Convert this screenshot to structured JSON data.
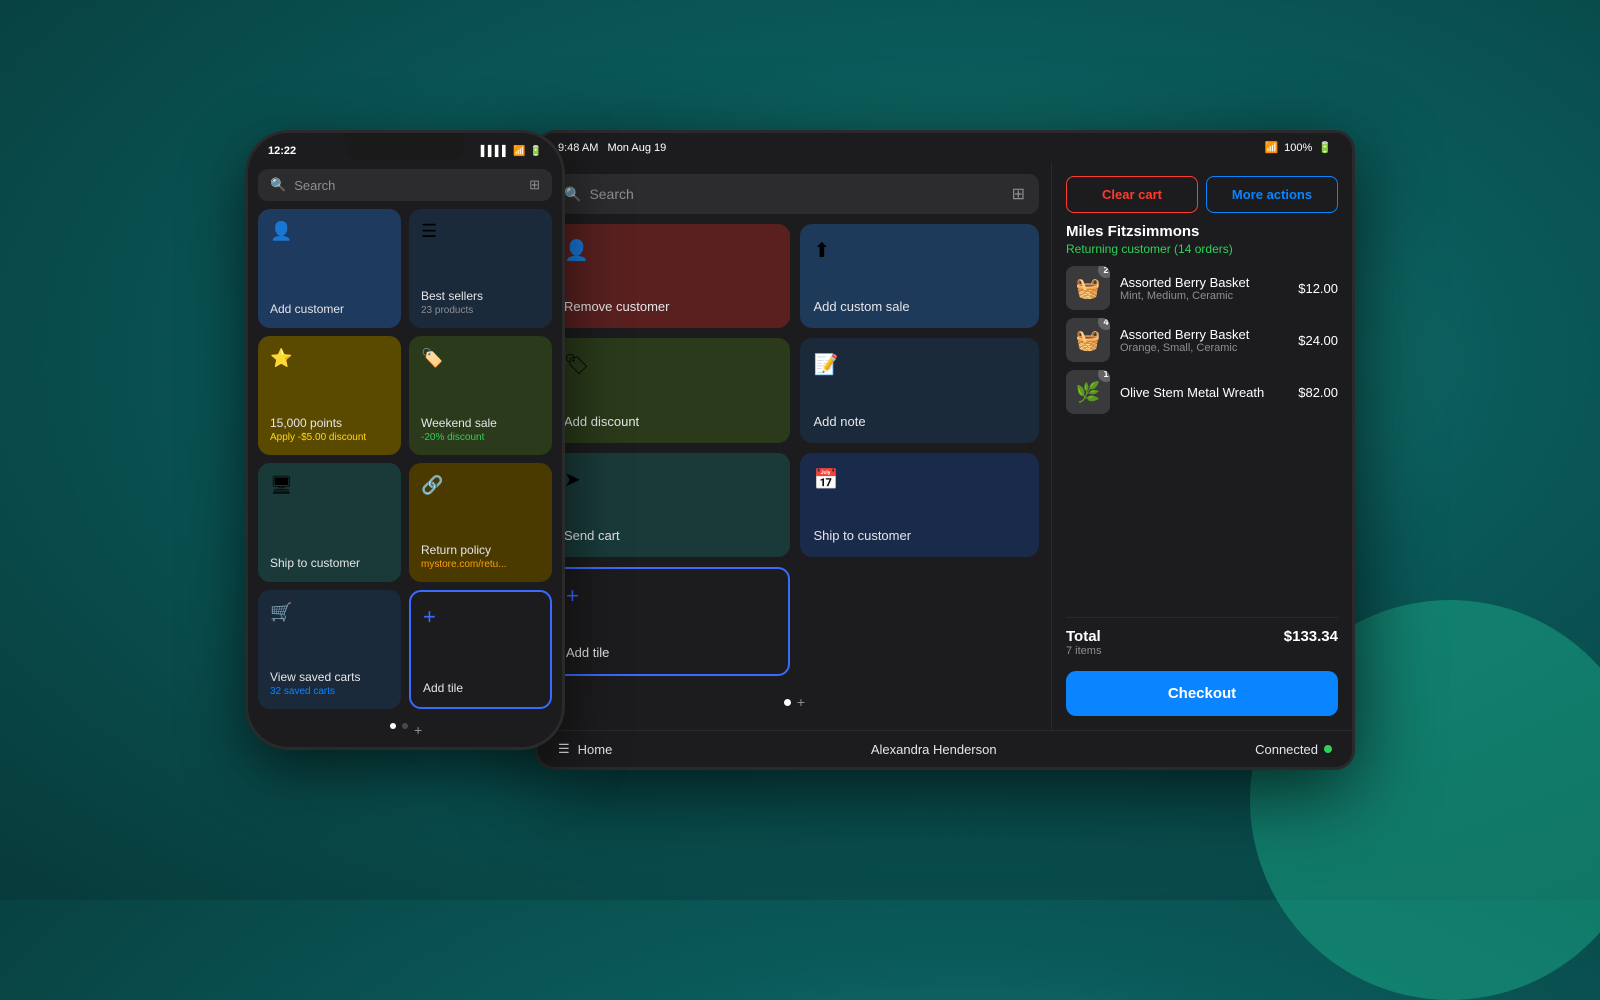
{
  "background": "#0e6e6e",
  "phone": {
    "status": {
      "time": "12:22",
      "signal": "▌▌▌▌",
      "wifi": "WiFi",
      "battery": "100%"
    },
    "search_placeholder": "Search",
    "tiles": [
      {
        "id": "add-customer",
        "label": "Add customer",
        "icon": "person",
        "color": "blue",
        "sub": null
      },
      {
        "id": "best-sellers",
        "label": "Best sellers",
        "icon": "list",
        "color": "dark-blue",
        "sub": "23 products",
        "sub_color": "gray"
      },
      {
        "id": "points",
        "label": "15,000 points",
        "icon": "star",
        "color": "gold",
        "sub": "Apply -$5.00 discount",
        "sub_color": "yellow"
      },
      {
        "id": "weekend-sale",
        "label": "Weekend sale",
        "icon": "tag",
        "color": "olive",
        "sub": "-20% discount",
        "sub_color": "green"
      },
      {
        "id": "ship-to-customer",
        "label": "Ship to customer",
        "icon": "ship",
        "color": "teal",
        "sub": null
      },
      {
        "id": "return-policy",
        "label": "Return policy",
        "icon": "link",
        "color": "brown-gold",
        "sub": "mystore.com/retu...",
        "sub_color": "orange"
      },
      {
        "id": "view-saved-carts",
        "label": "View saved carts",
        "icon": "cart",
        "color": "dark-blue",
        "sub": "32 saved carts",
        "sub_color": "blue-link"
      },
      {
        "id": "add-tile",
        "label": "Add tile",
        "icon": "+",
        "color": "add-tile"
      }
    ],
    "dots": [
      "active",
      "inactive",
      "add"
    ]
  },
  "tablet": {
    "status": {
      "time": "9:48 AM",
      "date": "Mon Aug 19",
      "wifi": "WiFi",
      "battery": "100%"
    },
    "search_placeholder": "Search",
    "tiles": [
      {
        "id": "remove-customer",
        "label": "Remove customer",
        "icon": "person-remove",
        "color": "red-brown"
      },
      {
        "id": "add-custom-sale",
        "label": "Add custom sale",
        "icon": "upload",
        "color": "steel-blue"
      },
      {
        "id": "add-discount",
        "label": "Add discount",
        "icon": "discount",
        "color": "olive-green"
      },
      {
        "id": "add-note",
        "label": "Add note",
        "icon": "note",
        "color": "dark-navy"
      },
      {
        "id": "send-cart",
        "label": "Send cart",
        "icon": "send",
        "color": "teal-dark"
      },
      {
        "id": "ship-to-customer",
        "label": "Ship to customer",
        "icon": "calendar",
        "color": "navy"
      },
      {
        "id": "add-tile",
        "label": "Add tile",
        "icon": "+",
        "color": "add-tile-tab"
      }
    ],
    "dots": [
      "active",
      "add"
    ],
    "cart": {
      "clear_label": "Clear cart",
      "more_label": "More actions",
      "customer_name": "Miles Fitzsimmons",
      "customer_status": "Returning customer (14 orders)",
      "items": [
        {
          "name": "Assorted Berry Basket",
          "variant": "Mint, Medium, Ceramic",
          "price": "$12.00",
          "qty": 2,
          "emoji": "🧺"
        },
        {
          "name": "Assorted Berry Basket",
          "variant": "Orange, Small, Ceramic",
          "price": "$24.00",
          "qty": 4,
          "emoji": "🧺"
        },
        {
          "name": "Olive Stem Metal Wreath",
          "variant": "",
          "price": "$82.00",
          "qty": 1,
          "emoji": "🌿"
        }
      ],
      "total_label": "Total",
      "total_items": "7 items",
      "total_amount": "$133.34",
      "checkout_label": "Checkout"
    },
    "bottom": {
      "menu_label": "Home",
      "center_label": "Alexandra Henderson",
      "status_label": "Connected"
    }
  }
}
